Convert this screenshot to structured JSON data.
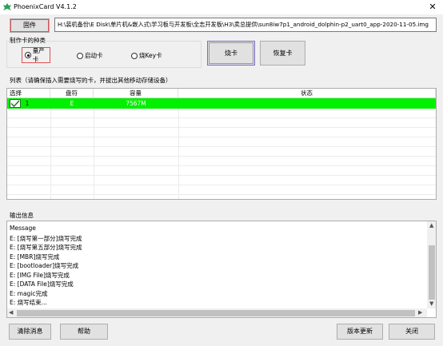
{
  "window": {
    "title": "PhoenixCard V4.1.2",
    "close_glyph": "✕"
  },
  "firmware": {
    "button_label": "固件",
    "path": "H:\\装机备份\\E Disk\\单片机&嵌入式\\学习板与开发板\\全志开发板\\H3\\卖总提供\\sun8iw7p1_android_dolphin-p2_uart0_app-2020-11-05.img"
  },
  "card_type": {
    "group_label": "制作卡的种类",
    "options": [
      {
        "label": "量产卡",
        "selected": true
      },
      {
        "label": "启动卡",
        "selected": false
      },
      {
        "label": "烧Key卡",
        "selected": false
      }
    ]
  },
  "actions": {
    "burn_label": "烧卡",
    "restore_label": "恢复卡"
  },
  "list": {
    "group_label": "列表（请确保插入需要烧写的卡，并拔出其他移动存储设备）",
    "columns": [
      "选择",
      "盘符",
      "容量",
      "状态"
    ],
    "rows": [
      {
        "checked": true,
        "index": "1",
        "drive": "E",
        "capacity": "7567M",
        "status": "",
        "row_color": "#00f000"
      }
    ]
  },
  "output": {
    "group_label": "输出信息",
    "lines": [
      "Message",
      "E: [烧写第一部分]烧写完成",
      "E: [烧写第五部分]烧写完成",
      "E: [MBR]烧写完成",
      "E: [bootloader]烧写完成",
      "E: [IMG File]烧写完成",
      "E: [DATA File]烧写完成",
      "E: magic完成",
      "E: 烧写结束..."
    ]
  },
  "footer": {
    "clear_label": "清除消息",
    "help_label": "帮助",
    "update_label": "版本更新",
    "close_label": "关闭"
  },
  "colors": {
    "status_ok": "#00f000",
    "highlight_border": "#e05050"
  }
}
